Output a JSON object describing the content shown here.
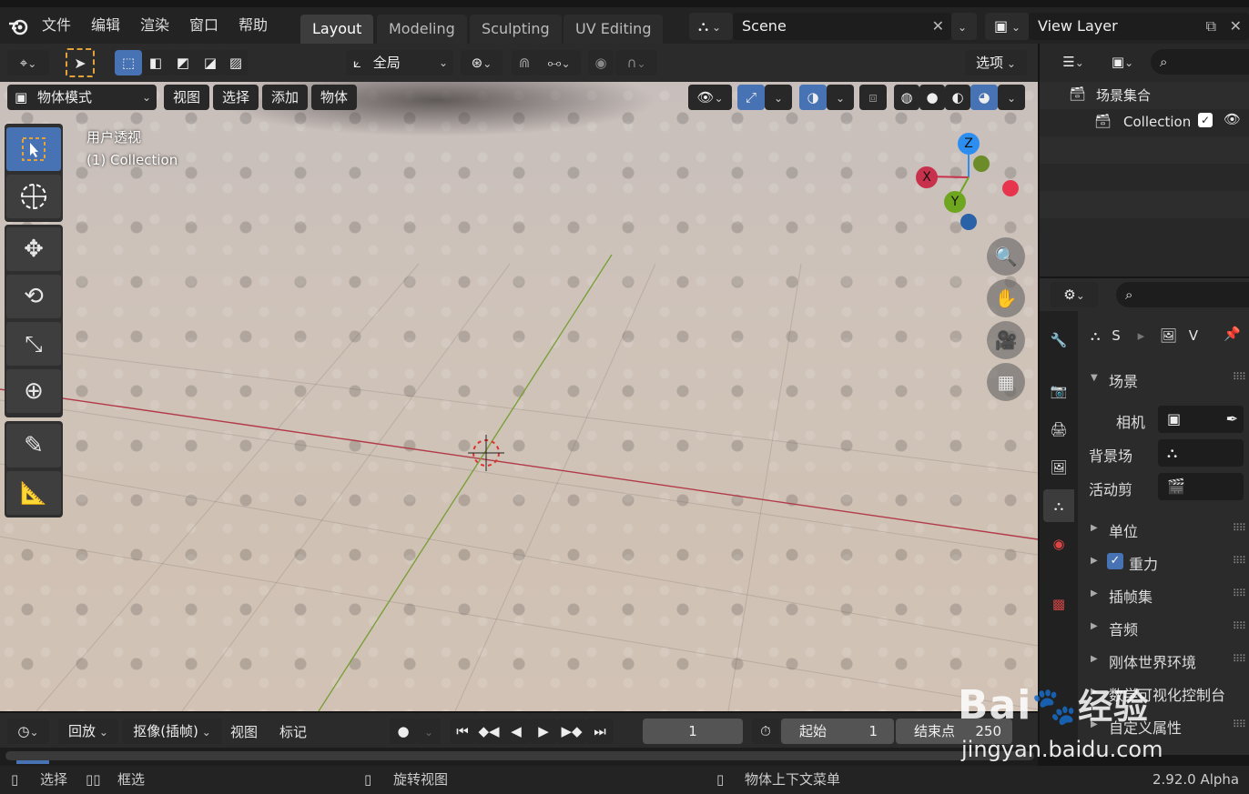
{
  "topbar": {
    "menus": [
      "文件",
      "编辑",
      "渲染",
      "窗口",
      "帮助"
    ],
    "workspaces": [
      "Layout",
      "Modeling",
      "Sculpting",
      "UV Editing"
    ],
    "active_workspace": "Layout",
    "scene": "Scene",
    "view_layer": "View Layer"
  },
  "header": {
    "transform_orientation": "全局",
    "options": "选项",
    "mode": "物体模式",
    "menus": [
      "视图",
      "选择",
      "添加",
      "物体"
    ]
  },
  "viewport": {
    "view_name": "用户透视",
    "collection_info": "(1) Collection",
    "gizmo": {
      "x": "X",
      "y": "Y",
      "z": "Z"
    }
  },
  "outliner": {
    "scene_collection": "场景集合",
    "collection": "Collection"
  },
  "properties": {
    "crumb_scene": "S",
    "crumb_view": "V",
    "section_scene": "场景",
    "camera_label": "相机",
    "background_label": "背景场",
    "active_clip_label": "活动剪",
    "panels": [
      "单位",
      "重力",
      "插帧集",
      "音频",
      "刚体世界环境",
      "数学可视化控制台",
      "自定义属性"
    ]
  },
  "timeline": {
    "playback": "回放",
    "keying": "抠像(插帧)",
    "view": "视图",
    "marker": "标记",
    "current_frame": "1",
    "start_label": "起始",
    "start_value": "1",
    "end_label": "结束点",
    "end_value": "250"
  },
  "statusbar": {
    "select": "选择",
    "box_select": "框选",
    "rotate_view": "旋转视图",
    "context_menu": "物体上下文菜单",
    "version": "2.92.0 Alpha"
  },
  "watermark": {
    "text1": "Bai",
    "text2": "经验",
    "url": "jingyan.baidu.com"
  },
  "colors": {
    "accent": "#4772b3",
    "x_axis": "#c8314b",
    "y_axis": "#6fa620",
    "z_axis": "#2c8ef0"
  }
}
